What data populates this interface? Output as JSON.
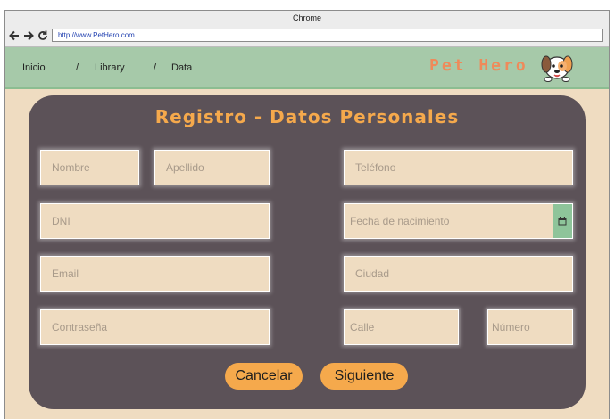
{
  "window": {
    "title": "Chrome",
    "url": "http://www.PetHero.com"
  },
  "breadcrumb": {
    "items": [
      "Inicio",
      "Library",
      "Data"
    ],
    "separator": "/"
  },
  "brand": {
    "name": "Pet Hero",
    "logo_icon": "dog-icon"
  },
  "form": {
    "title": "Registro - Datos Personales",
    "fields": {
      "nombre": "Nombre",
      "apellido": "Apellido",
      "telefono": "Teléfono",
      "dni": "DNI",
      "fecha_nacimiento": "Fecha de nacimiento",
      "email": "Email",
      "ciudad": "Ciudad",
      "contrasena": "Contraseña",
      "calle": "Calle",
      "numero": "Número"
    },
    "buttons": {
      "cancel": "Cancelar",
      "next": "Siguiente"
    }
  },
  "colors": {
    "page_bg": "#efdcc1",
    "header_bg": "#a6c9a9",
    "panel_bg": "#5c5258",
    "accent": "#f5a94c",
    "brand": "#ef8a5a",
    "calendar_bg": "#8ec49a"
  }
}
